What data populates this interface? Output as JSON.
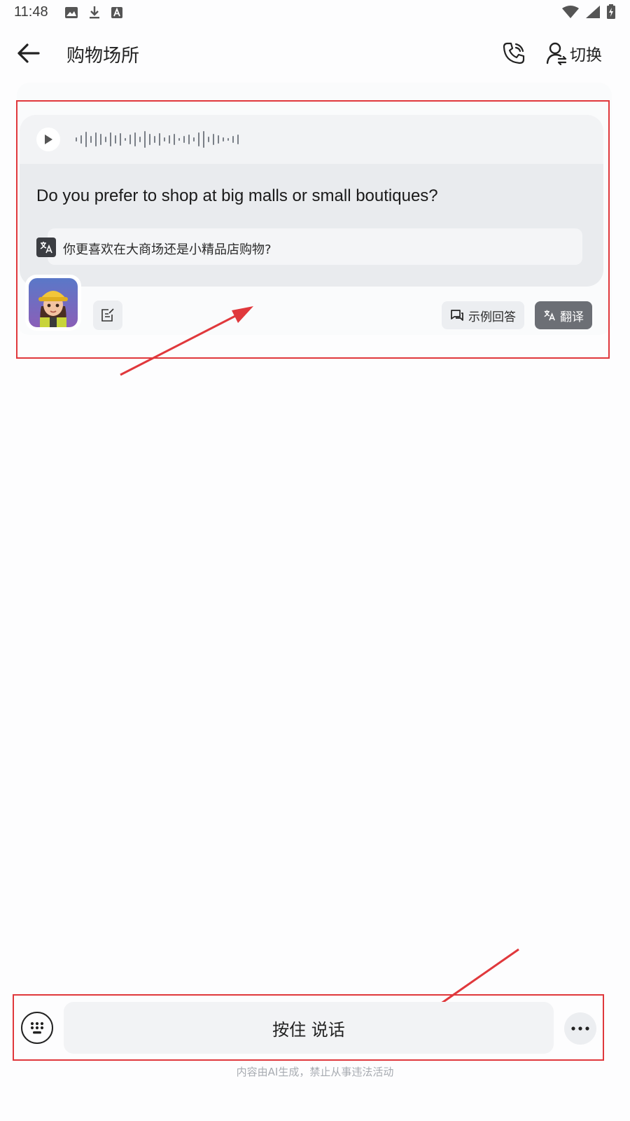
{
  "status_bar": {
    "time": "11:48",
    "left_icons": [
      "image-icon",
      "download-icon",
      "text-icon"
    ],
    "right_icons": [
      "wifi-icon",
      "signal-icon",
      "battery-charging-icon"
    ]
  },
  "header": {
    "title": "购物场所",
    "back_icon": "arrow-left-icon",
    "call_icon": "phone-icon",
    "switch_label": "切换",
    "switch_icon": "user-switch-icon"
  },
  "message": {
    "audio": {
      "play_icon": "play-icon",
      "waveform_icon": "waveform-icon"
    },
    "text": "Do you prefer to shop at big malls or small boutiques?",
    "translation": "你更喜欢在大商场还是小精品店购物?",
    "translation_icon": "translate-icon",
    "avatar_icon": "avatar-girl-icon",
    "note_icon": "note-edit-icon",
    "sample_answer_label": "示例回答",
    "sample_answer_icon": "chat-bubble-icon",
    "translate_label": "翻译",
    "translate_button_icon": "translate-icon"
  },
  "input_bar": {
    "keyboard_icon": "keyboard-icon",
    "hold_to_talk_label": "按住 说话",
    "more_icon": "more-horizontal-icon"
  },
  "disclaimer": "内容由AI生成，禁止从事违法活动",
  "colors": {
    "annotation_red": "#e0383c",
    "bubble_bg": "#e9ebee",
    "translate_button_bg": "#6c6f75"
  }
}
